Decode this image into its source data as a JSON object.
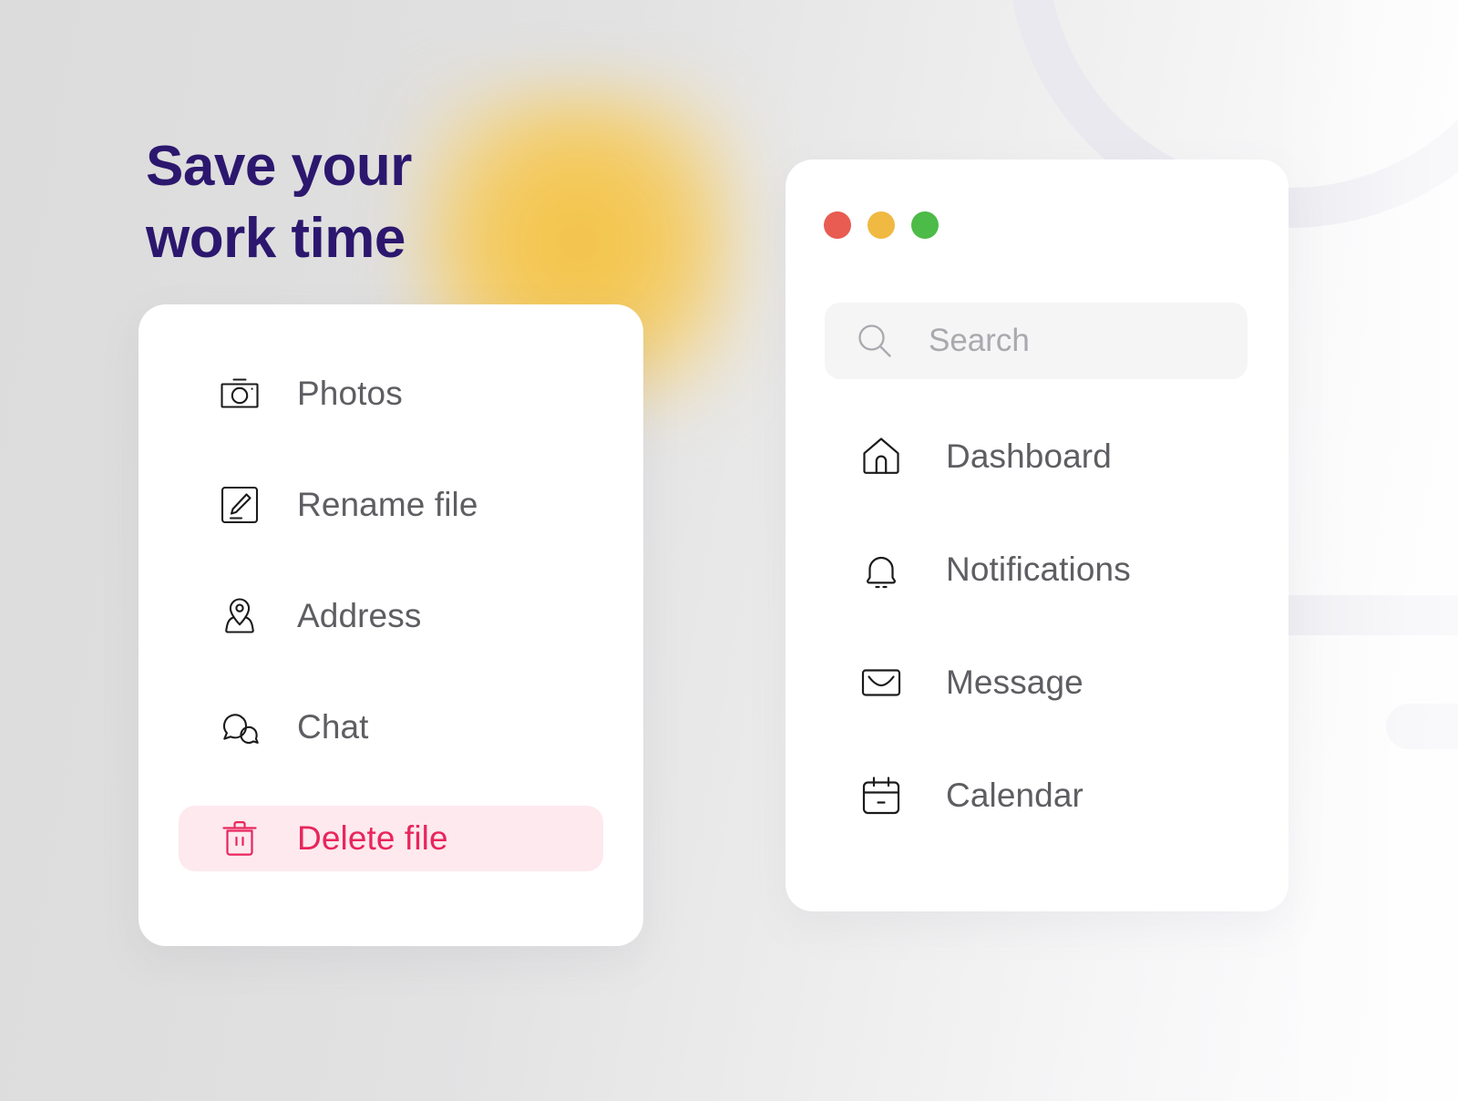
{
  "headline": "Save your\nwork time",
  "colors": {
    "headline": "#2c176e",
    "danger_text": "#e9255c",
    "danger_bg": "#fde9ee",
    "label": "#5e5e62",
    "placeholder": "#a9a9ae",
    "dot_red": "#e85c52",
    "dot_yellow": "#f0b942",
    "dot_green": "#4cbb47",
    "glow_yellow": "#f3c44a",
    "deco_lavender": "#e9e8ee"
  },
  "menu_card": {
    "items": [
      {
        "label": "Photos",
        "icon": "camera-icon",
        "state": "default"
      },
      {
        "label": "Rename file",
        "icon": "edit-square-icon",
        "state": "default"
      },
      {
        "label": "Address",
        "icon": "map-pin-icon",
        "state": "default"
      },
      {
        "label": "Chat",
        "icon": "chat-bubbles-icon",
        "state": "default"
      },
      {
        "label": "Delete file",
        "icon": "trash-icon",
        "state": "danger"
      }
    ]
  },
  "window_card": {
    "traffic_lights": [
      {
        "name": "close-dot",
        "color": "#e85c52"
      },
      {
        "name": "minimize-dot",
        "color": "#f0b942"
      },
      {
        "name": "maximize-dot",
        "color": "#4cbb47"
      }
    ],
    "search": {
      "icon": "search-icon",
      "value": "",
      "placeholder": "Search"
    },
    "nav_items": [
      {
        "label": "Dashboard",
        "icon": "home-icon"
      },
      {
        "label": "Notifications",
        "icon": "bell-icon"
      },
      {
        "label": "Message",
        "icon": "envelope-icon"
      },
      {
        "label": "Calendar",
        "icon": "calendar-icon"
      }
    ]
  }
}
